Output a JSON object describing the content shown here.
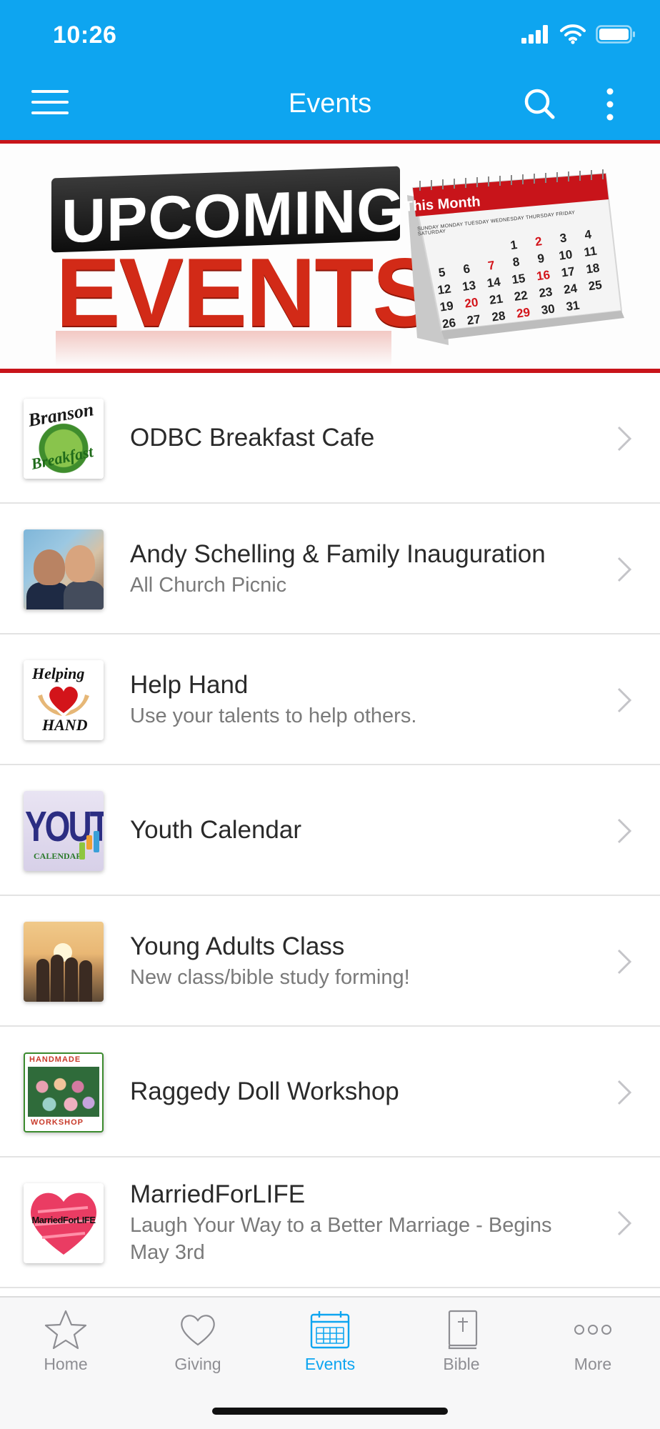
{
  "status_bar": {
    "time": "10:26"
  },
  "app_bar": {
    "title": "Events"
  },
  "banner": {
    "line1": "UPCOMING",
    "line2": "EVENTS",
    "calendar_label": "This Month",
    "calendar_days": "SUNDAY MONDAY TUESDAY WEDNESDAY THURSDAY FRIDAY SATURDAY",
    "calendar_rows": [
      [
        "",
        "",
        "",
        "1",
        "2",
        "3",
        "4"
      ],
      [
        "5",
        "6",
        "7",
        "8",
        "9",
        "10",
        "11"
      ],
      [
        "12",
        "13",
        "14",
        "15",
        "16",
        "17",
        "18"
      ],
      [
        "19",
        "20",
        "21",
        "22",
        "23",
        "24",
        "25"
      ],
      [
        "26",
        "27",
        "28",
        "29",
        "30",
        "31",
        ""
      ]
    ]
  },
  "events": [
    {
      "title": "ODBC Breakfast Cafe",
      "subtitle": "",
      "thumb": "branson-breakfast",
      "thumb_text": [
        "Branson",
        "Breakfast"
      ]
    },
    {
      "title": "Andy Schelling & Family Inauguration",
      "subtitle": "All Church Picnic",
      "thumb": "couple-photo"
    },
    {
      "title": "Help Hand",
      "subtitle": "Use your talents to help others.",
      "thumb": "helping-hand",
      "thumb_text": [
        "Helping",
        "HAND"
      ]
    },
    {
      "title": "Youth Calendar",
      "subtitle": "",
      "thumb": "youth-calendar",
      "thumb_text": [
        "YOUTH",
        "CALENDAR"
      ]
    },
    {
      "title": "Young Adults Class",
      "subtitle": "New class/bible study forming!",
      "thumb": "friends-sunset-photo"
    },
    {
      "title": "Raggedy Doll Workshop",
      "subtitle": "",
      "thumb": "handmade-workshop",
      "thumb_text": [
        "HANDMADE",
        "WORKSHOP"
      ]
    },
    {
      "title": "MarriedForLIFE",
      "subtitle": "Laugh Your Way to a Better Marriage - Begins May 3rd",
      "thumb": "married-for-life",
      "thumb_text": [
        "MarriedForLIFE"
      ]
    }
  ],
  "tabs": [
    {
      "label": "Home",
      "icon": "star-icon",
      "active": false
    },
    {
      "label": "Giving",
      "icon": "heart-icon",
      "active": false
    },
    {
      "label": "Events",
      "icon": "calendar-icon",
      "active": true
    },
    {
      "label": "Bible",
      "icon": "bible-icon",
      "active": false
    },
    {
      "label": "More",
      "icon": "more-dots-icon",
      "active": false
    }
  ],
  "colors": {
    "primary": "#0ea5f0",
    "accent_red": "#c8141a",
    "tab_inactive": "#8e8e93"
  }
}
